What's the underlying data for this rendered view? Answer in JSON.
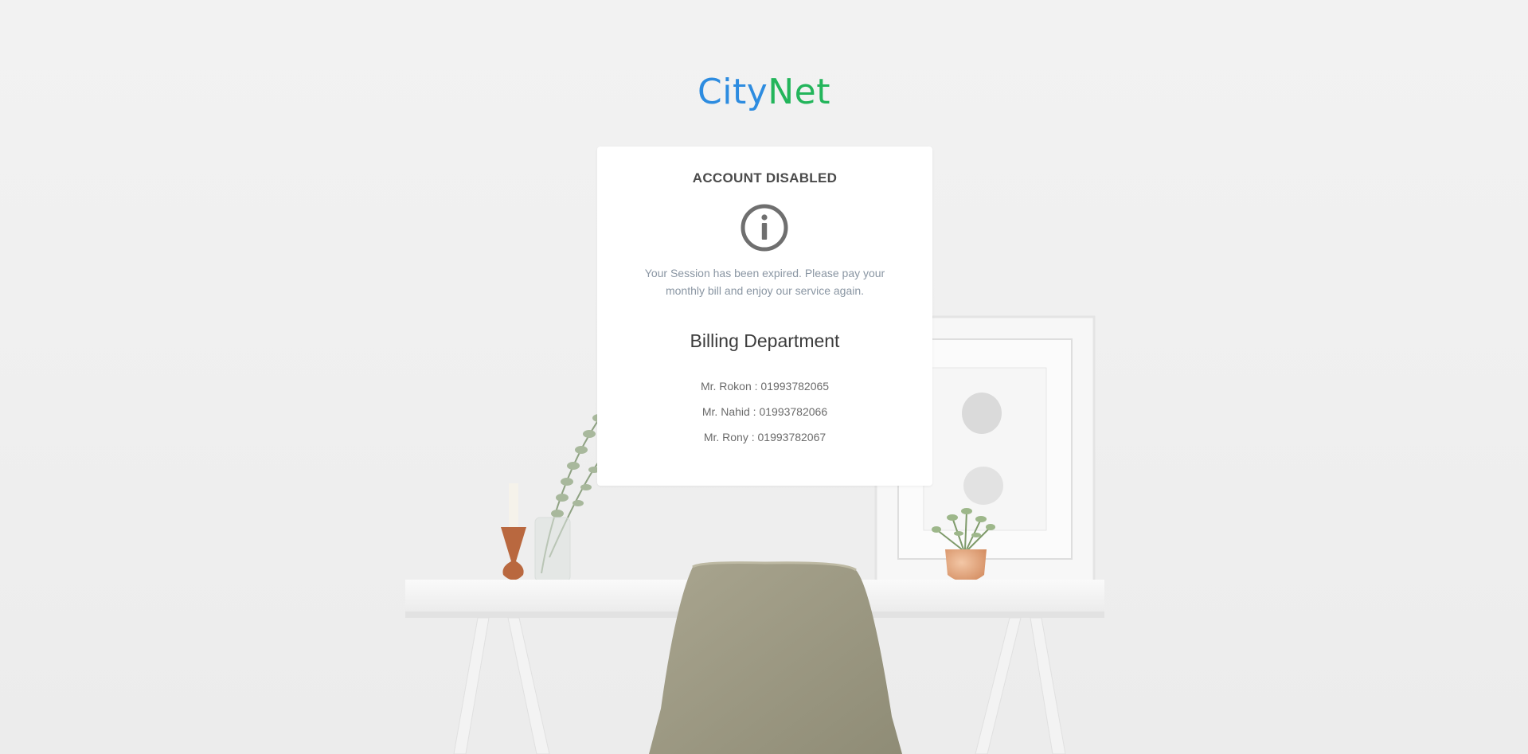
{
  "brand": {
    "part1": "City",
    "part2": "Net",
    "color1": "#2d8ce0",
    "color2": "#23b55b"
  },
  "notice": {
    "title": "ACCOUNT DISABLED",
    "icon": "info-circle-icon",
    "message": "Your Session has been expired. Please pay your monthly bill and enjoy our service again."
  },
  "billing": {
    "heading": "Billing Department",
    "contacts": [
      "Mr. Rokon : 01993782065",
      "Mr. Nahid : 01993782066",
      "Mr. Rony : 01993782067"
    ]
  }
}
